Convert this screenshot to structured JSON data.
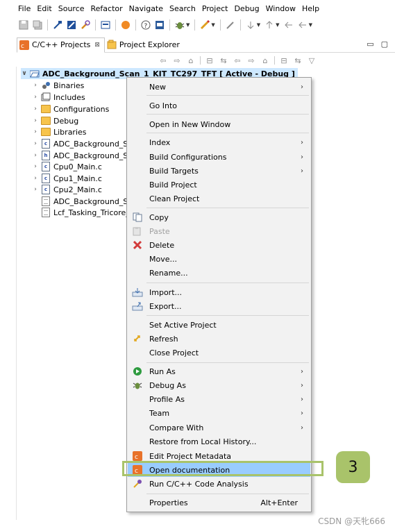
{
  "menubar": [
    "File",
    "Edit",
    "Source",
    "Refactor",
    "Navigate",
    "Search",
    "Project",
    "Debug",
    "Window",
    "Help"
  ],
  "tabs": {
    "projects": "C/C++ Projects",
    "projects_close": "⊠",
    "explorer": "Project Explorer"
  },
  "tree": {
    "project": "ADC_Background_Scan_1_KIT_TC297_TFT [ Active - Debug ]",
    "items": [
      {
        "label": "Binaries",
        "icon": "binaries-icon"
      },
      {
        "label": "Includes",
        "icon": "includes-icon"
      },
      {
        "label": "Configurations",
        "icon": "folder-icon"
      },
      {
        "label": "Debug",
        "icon": "folder-icon"
      },
      {
        "label": "Libraries",
        "icon": "folder-icon"
      },
      {
        "label": "ADC_Background_Sca",
        "icon": "c-source-file-icon"
      },
      {
        "label": "ADC_Background_Sca",
        "icon": "header-file-icon"
      },
      {
        "label": "Cpu0_Main.c",
        "icon": "c-source-file-icon"
      },
      {
        "label": "Cpu1_Main.c",
        "icon": "c-source-file-icon"
      },
      {
        "label": "Cpu2_Main.c",
        "icon": "c-source-file-icon"
      },
      {
        "label": "ADC_Background_Sca",
        "icon": "text-file-icon"
      },
      {
        "label": "Lcf_Tasking_Tricore_T",
        "icon": "text-file-icon"
      }
    ]
  },
  "context_menu": {
    "new": "New",
    "go_into": "Go Into",
    "open_new_window": "Open in New Window",
    "index": "Index",
    "build_configurations": "Build Configurations",
    "build_targets": "Build Targets",
    "build_project": "Build Project",
    "clean_project": "Clean Project",
    "copy": "Copy",
    "paste": "Paste",
    "delete": "Delete",
    "move": "Move...",
    "rename": "Rename...",
    "import": "Import...",
    "export": "Export...",
    "set_active_project": "Set Active Project",
    "refresh": "Refresh",
    "close_project": "Close Project",
    "run_as": "Run As",
    "debug_as": "Debug As",
    "profile_as": "Profile As",
    "team": "Team",
    "compare_with": "Compare With",
    "restore_history": "Restore from Local History...",
    "edit_metadata": "Edit Project Metadata",
    "open_documentation": "Open documentation",
    "run_analysis": "Run C/C++ Code Analysis",
    "properties": "Properties",
    "properties_shortcut": "Alt+Enter"
  },
  "annotation": {
    "badge": "3"
  },
  "watermark": "CSDN @天牝666",
  "colors": {
    "highlight": "#99ccff",
    "callout": "#a9c36a",
    "menu_bg": "#f2f2f2",
    "selection": "#cde8ff"
  }
}
